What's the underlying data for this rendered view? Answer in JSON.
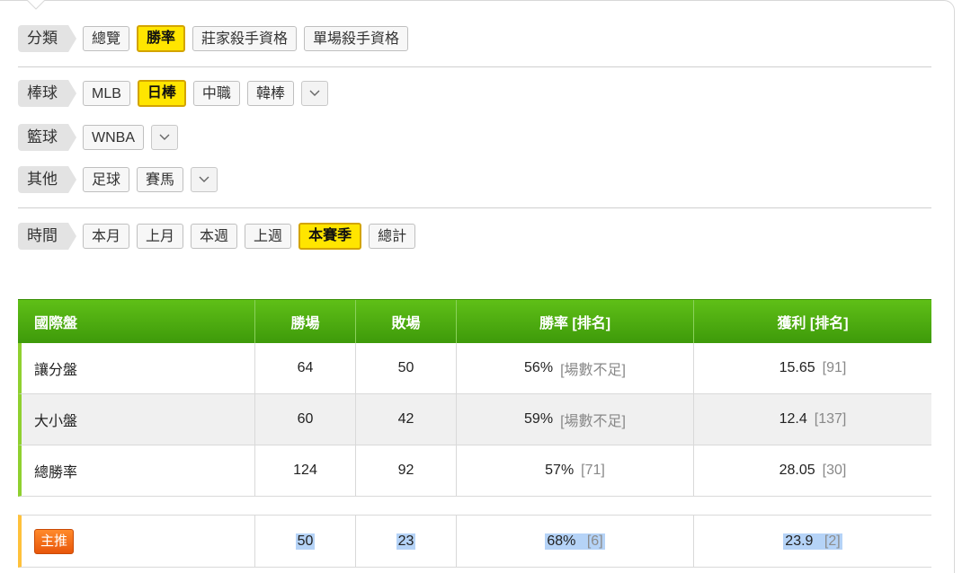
{
  "filters": {
    "category": {
      "label": "分類",
      "buttons": [
        {
          "label": "總覽",
          "active": false
        },
        {
          "label": "勝率",
          "active": true
        },
        {
          "label": "莊家殺手資格",
          "active": false
        },
        {
          "label": "單場殺手資格",
          "active": false
        }
      ]
    },
    "baseball": {
      "label": "棒球",
      "buttons": [
        {
          "label": "MLB",
          "active": false
        },
        {
          "label": "日棒",
          "active": true
        },
        {
          "label": "中職",
          "active": false
        },
        {
          "label": "韓棒",
          "active": false
        }
      ]
    },
    "basketball": {
      "label": "籃球",
      "buttons": [
        {
          "label": "WNBA",
          "active": false
        }
      ]
    },
    "other": {
      "label": "其他",
      "buttons": [
        {
          "label": "足球",
          "active": false
        },
        {
          "label": "賽馬",
          "active": false
        }
      ]
    },
    "time": {
      "label": "時間",
      "buttons": [
        {
          "label": "本月",
          "active": false
        },
        {
          "label": "上月",
          "active": false
        },
        {
          "label": "本週",
          "active": false
        },
        {
          "label": "上週",
          "active": false
        },
        {
          "label": "本賽季",
          "active": true
        },
        {
          "label": "總計",
          "active": false
        }
      ]
    }
  },
  "table": {
    "headers": [
      "國際盤",
      "勝場",
      "敗場",
      "勝率 [排名]",
      "獲利 [排名]"
    ],
    "rows": [
      {
        "name": "讓分盤",
        "wins": "64",
        "losses": "50",
        "rate": "56%",
        "rate_rank": "[場數不足]",
        "profit": "15.65",
        "profit_rank": "[91]"
      },
      {
        "name": "大小盤",
        "wins": "60",
        "losses": "42",
        "rate": "59%",
        "rate_rank": "[場數不足]",
        "profit": "12.4",
        "profit_rank": "[137]"
      },
      {
        "name": "總勝率",
        "wins": "124",
        "losses": "92",
        "rate": "57%",
        "rate_rank": "[71]",
        "profit": "28.05",
        "profit_rank": "[30]"
      }
    ],
    "featured": {
      "badge": "主推",
      "wins": "50",
      "losses": "23",
      "rate": "68%",
      "rate_rank": "[6]",
      "profit": "23.9",
      "profit_rank": "[2]"
    }
  },
  "colors": {
    "active_button": "#ffe500",
    "header_green": "#4faf10",
    "featured_badge": "#f0650f",
    "selection_highlight": "#b5d3f7"
  },
  "icons": {
    "dropdown": "chevron-down-icon"
  }
}
